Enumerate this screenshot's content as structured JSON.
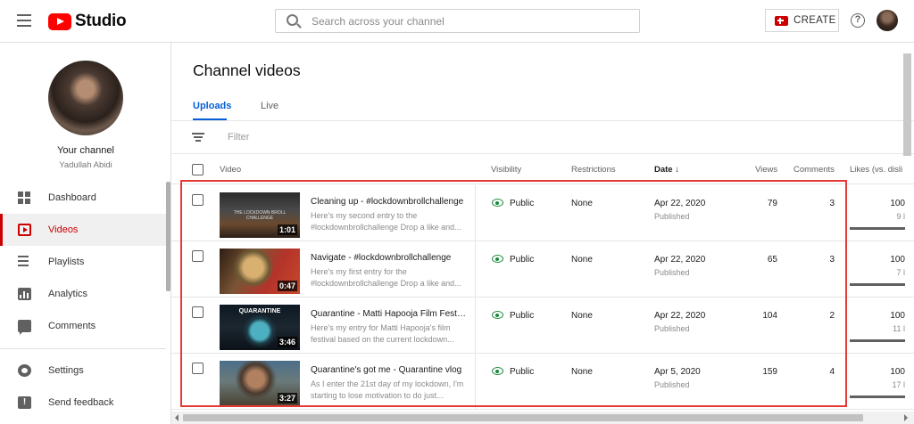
{
  "header": {
    "logo_text": "Studio",
    "search_placeholder": "Search across your channel",
    "create_label": "CREATE",
    "help_label": "?"
  },
  "sidebar": {
    "channel_title": "Your channel",
    "channel_name": "Yadullah Abidi",
    "items": [
      {
        "label": "Dashboard",
        "icon": "dashboard-icon"
      },
      {
        "label": "Videos",
        "icon": "videos-icon",
        "active": true
      },
      {
        "label": "Playlists",
        "icon": "playlists-icon"
      },
      {
        "label": "Analytics",
        "icon": "analytics-icon"
      },
      {
        "label": "Comments",
        "icon": "comments-icon"
      }
    ],
    "bottom_items": [
      {
        "label": "Settings",
        "icon": "gear-icon"
      },
      {
        "label": "Send feedback",
        "icon": "feedback-icon"
      }
    ]
  },
  "main": {
    "page_title": "Channel videos",
    "tabs": [
      {
        "label": "Uploads",
        "active": true
      },
      {
        "label": "Live",
        "active": false
      }
    ],
    "filter_placeholder": "Filter",
    "columns": {
      "video": "Video",
      "visibility": "Visibility",
      "restrictions": "Restrictions",
      "date": "Date",
      "date_sort": "↓",
      "views": "Views",
      "comments": "Comments",
      "likes": "Likes (vs. disli"
    },
    "videos": [
      {
        "title": "Cleaning up - #lockdownbrollchallenge",
        "description": "Here's my second entry to the #lockdownbrollchallenge Drop a like and...",
        "duration": "1:01",
        "thumb_caption": "THE LOCKDOWN BROLL CHALLENGE",
        "visibility": "Public",
        "restrictions": "None",
        "date": "Apr 22, 2020",
        "status": "Published",
        "views": "79",
        "comments": "3",
        "likes": "100",
        "likes_count": "9 l"
      },
      {
        "title": "Navigate - #lockdownbrollchallenge",
        "description": "Here's my first entry for the #lockdownbrollchallenge Drop a like and...",
        "duration": "0:47",
        "thumb_caption": "",
        "visibility": "Public",
        "restrictions": "None",
        "date": "Apr 22, 2020",
        "status": "Published",
        "views": "65",
        "comments": "3",
        "likes": "100",
        "likes_count": "7 l"
      },
      {
        "title": "Quarantine - Matti Hapooja Film Festival",
        "description": "Here's my entry for Matti Hapooja's film festival based on the current lockdown...",
        "duration": "3:46",
        "thumb_caption": "QUARANTINE",
        "visibility": "Public",
        "restrictions": "None",
        "date": "Apr 22, 2020",
        "status": "Published",
        "views": "104",
        "comments": "2",
        "likes": "100",
        "likes_count": "11 l"
      },
      {
        "title": "Quarantine's got me - Quarantine vlog",
        "description": "As I enter the 21st day of my lockdown, I'm starting to lose motivation to do just...",
        "duration": "3:27",
        "thumb_caption": "",
        "visibility": "Public",
        "restrictions": "None",
        "date": "Apr 5, 2020",
        "status": "Published",
        "views": "159",
        "comments": "4",
        "likes": "100",
        "likes_count": "17 l"
      }
    ]
  },
  "colors": {
    "brand_red": "#ff0000",
    "accent_blue": "#065fd4",
    "active_red": "#cc0000",
    "public_green": "#1b8a3a",
    "highlight_border": "#e53935"
  }
}
